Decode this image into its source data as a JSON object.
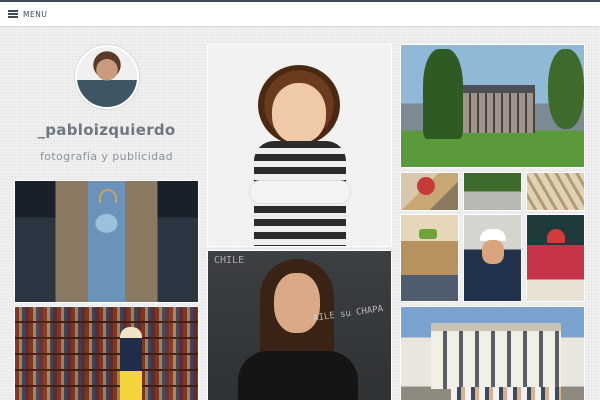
{
  "topbar": {
    "menu_label": "MENU"
  },
  "profile": {
    "username": "_pabloizquierdo",
    "tagline": "fotografía y publicidad"
  },
  "photos": {
    "woman_chalk_text": "AILE su CHAPA",
    "woman_chalk_corner": "CHILE"
  },
  "colors": {
    "topbar_border": "#3f4a55",
    "text_primary": "#6d7882",
    "text_secondary": "#8a949c",
    "page_background": "#f1f1f1"
  }
}
